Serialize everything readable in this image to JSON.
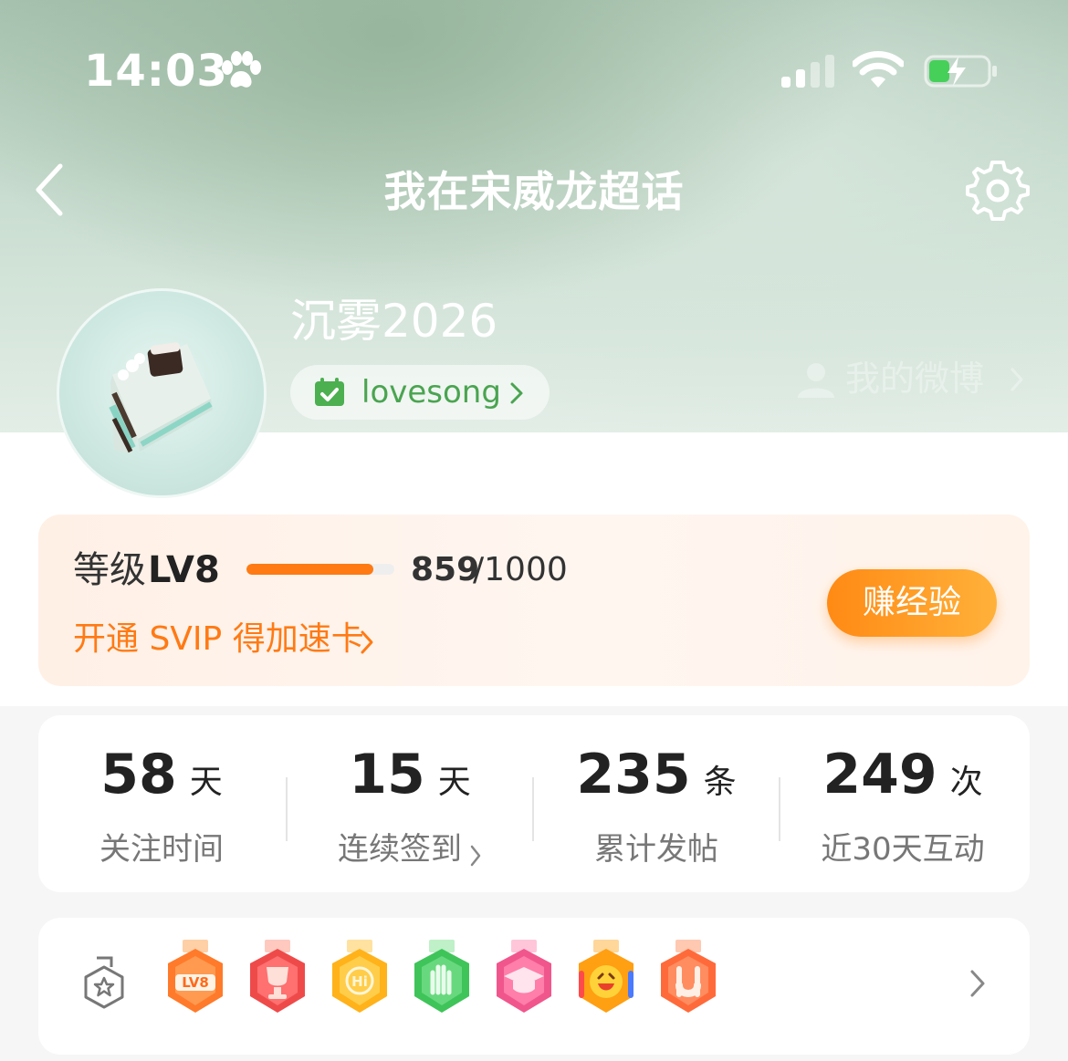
{
  "status_bar": {
    "time": "14:03",
    "icons": [
      "paw-icon",
      "signal-icon",
      "wifi-icon",
      "battery-charging-icon"
    ]
  },
  "nav": {
    "title": "我在宋威龙超话",
    "back_icon": "chevron-left-icon",
    "settings_icon": "gear-icon"
  },
  "profile": {
    "avatar_icon": "cake-avatar",
    "name": "沉雾2026",
    "tag": "lovesong",
    "weibo_link": "我的微博"
  },
  "level": {
    "label": "等级",
    "value": "LV8",
    "current": "859",
    "total": "/1000",
    "progress": 0.859,
    "svip_link": "开通 SVIP 得加速卡",
    "earn_button": "赚经验",
    "accent": "#ff7a12"
  },
  "stats": [
    {
      "value": "58",
      "unit": "天",
      "label": "关注时间",
      "has_chevron": false
    },
    {
      "value": "15",
      "unit": "天",
      "label": "连续签到",
      "has_chevron": true
    },
    {
      "value": "235",
      "unit": "条",
      "label": "累计发帖",
      "has_chevron": false
    },
    {
      "value": "249",
      "unit": "次",
      "label": "近30天互动",
      "has_chevron": false
    }
  ],
  "badges": {
    "shelf_icon": "badge-shelf-icon",
    "items": [
      {
        "icon": "lv8-badge-icon",
        "text": "LV8",
        "color": "#ff7a2a"
      },
      {
        "icon": "trophy-badge-icon",
        "text": "",
        "color": "#ef4a4a"
      },
      {
        "icon": "hi-badge-icon",
        "text": "Hi",
        "color": "#ffb21a"
      },
      {
        "icon": "hand-badge-icon",
        "text": "",
        "color": "#3fc45a"
      },
      {
        "icon": "graduation-cap-badge-icon",
        "text": "",
        "color": "#f0568c"
      },
      {
        "icon": "cheering-face-badge-icon",
        "text": "",
        "color": "#ff9f12"
      },
      {
        "icon": "rock-hand-badge-icon",
        "text": "",
        "color": "#ff6a3a"
      }
    ]
  }
}
